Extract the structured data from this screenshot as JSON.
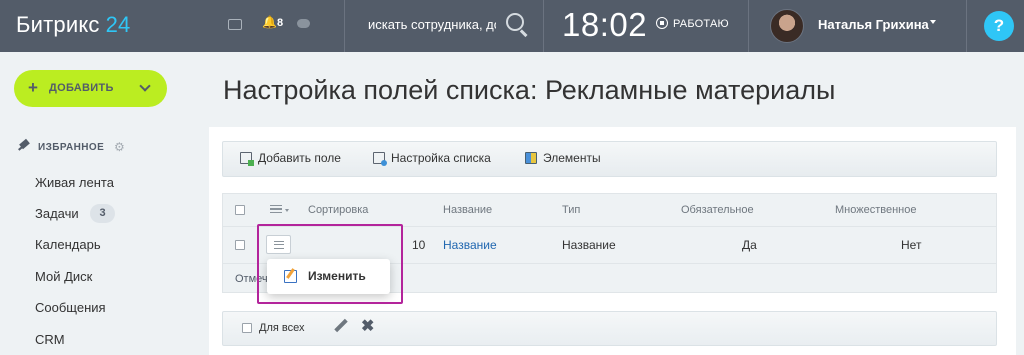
{
  "header": {
    "logo_text": "Битрикс",
    "logo_num": "24",
    "notification_count": "8",
    "search_placeholder": "искать сотрудника, документ",
    "clock": "18:02",
    "status": "РАБОТАЮ",
    "user_name": "Наталья Грихина",
    "help": "?"
  },
  "sidebar": {
    "add_label": "ДОБАВИТЬ",
    "favorites_title": "ИЗБРАННОЕ",
    "items": [
      {
        "label": "Живая лента"
      },
      {
        "label": "Задачи",
        "badge": "3"
      },
      {
        "label": "Календарь"
      },
      {
        "label": "Мой Диск"
      },
      {
        "label": "Сообщения"
      },
      {
        "label": "CRM"
      }
    ]
  },
  "main": {
    "title": "Настройка полей списка: Рекламные материалы",
    "toolbar": {
      "add_field": "Добавить поле",
      "list_settings": "Настройка списка",
      "elements": "Элементы"
    },
    "columns": [
      "Сортировка",
      "Название",
      "Тип",
      "Обязательное",
      "Множественное"
    ],
    "rows": [
      {
        "sort": "10",
        "name": "Название",
        "type": "Название",
        "required": "Да",
        "multiple": "Нет"
      }
    ],
    "footer_text": "Отмеч",
    "context_menu": {
      "edit": "Изменить"
    },
    "action_bar": {
      "for_all": "Для всех"
    }
  }
}
